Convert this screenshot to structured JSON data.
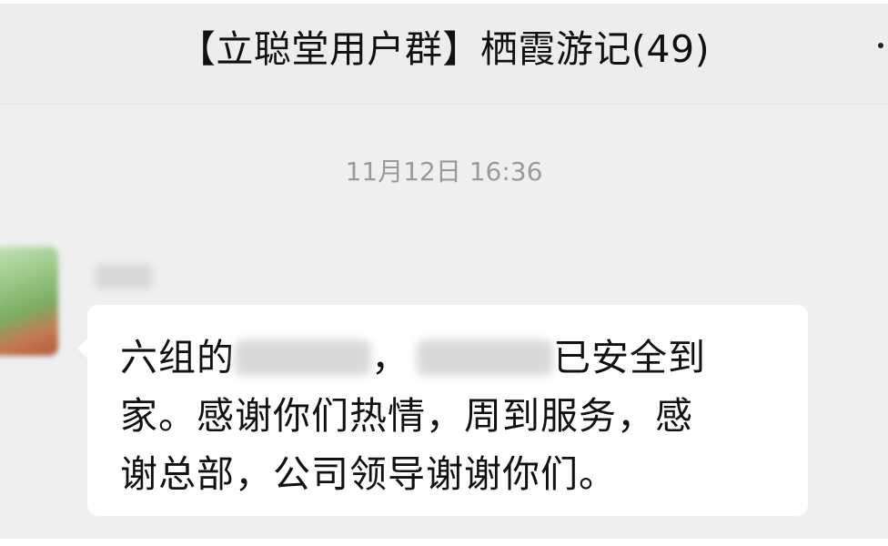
{
  "header": {
    "title": "【立聪堂用户群】栖霞游记(49)",
    "more_icon": "more-dots-icon"
  },
  "chat": {
    "timestamp": "11月12日 16:36",
    "message": {
      "sender_redacted": true,
      "line1_prefix": "六组的",
      "line1_separator": "，",
      "line1_suffix": "已安全到",
      "line2": "家。感谢你们热情，周到服务，感",
      "line3": "谢总部，公司领导谢谢你们。"
    }
  }
}
